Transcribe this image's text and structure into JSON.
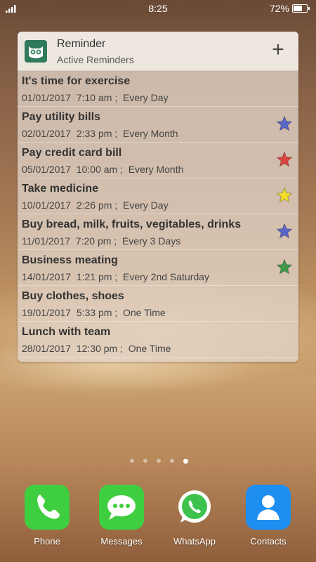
{
  "status_bar": {
    "time": "8:25",
    "battery": "72%",
    "battery_level": 0.72
  },
  "widget": {
    "app_name": "Reminder",
    "subtitle": "Active Reminders",
    "add_label": "+",
    "reminders": [
      {
        "title": "It's time for exercise",
        "date": "01/01/2017  7:10 am ;",
        "repeat": "Every Day",
        "star": "none"
      },
      {
        "title": "Pay utility bills",
        "date": "02/01/2017  2:33 pm ;",
        "repeat": "Every Month",
        "star": "#5a66c8"
      },
      {
        "title": "Pay credit card bill",
        "date": "05/01/2017  10:00 am ;",
        "repeat": "Every Month",
        "star": "#d9453f"
      },
      {
        "title": "Take medicine",
        "date": "10/01/2017  2:26 pm ;",
        "repeat": "Every Day",
        "star": "#f2dd2a"
      },
      {
        "title": "Buy bread,  milk,  fruits,  vegitables,  drinks",
        "date": "11/01/2017  7:20 pm ;",
        "repeat": "Every 3 Days",
        "star": "#5a66c8"
      },
      {
        "title": "Business meating",
        "date": "14/01/2017  1:21 pm ;",
        "repeat": "Every 2nd Saturday",
        "star": "#3f9a48"
      },
      {
        "title": "Buy clothes, shoes",
        "date": "19/01/2017  5:33 pm ;",
        "repeat": "One Time",
        "star": "none"
      },
      {
        "title": "Lunch with team",
        "date": "28/01/2017  12:30 pm ;",
        "repeat": "One Time",
        "star": "none"
      }
    ]
  },
  "page_indicator": {
    "count": 5,
    "active": 4
  },
  "dock": [
    {
      "label": "Phone",
      "icon": "phone-icon",
      "color": "#3fce3f"
    },
    {
      "label": "Messages",
      "icon": "messages-icon",
      "color": "#3fce3f"
    },
    {
      "label": "WhatsApp",
      "icon": "whatsapp-icon",
      "color": "#ffffff"
    },
    {
      "label": "Contacts",
      "icon": "contacts-icon",
      "color": "#1e8ff0"
    }
  ]
}
